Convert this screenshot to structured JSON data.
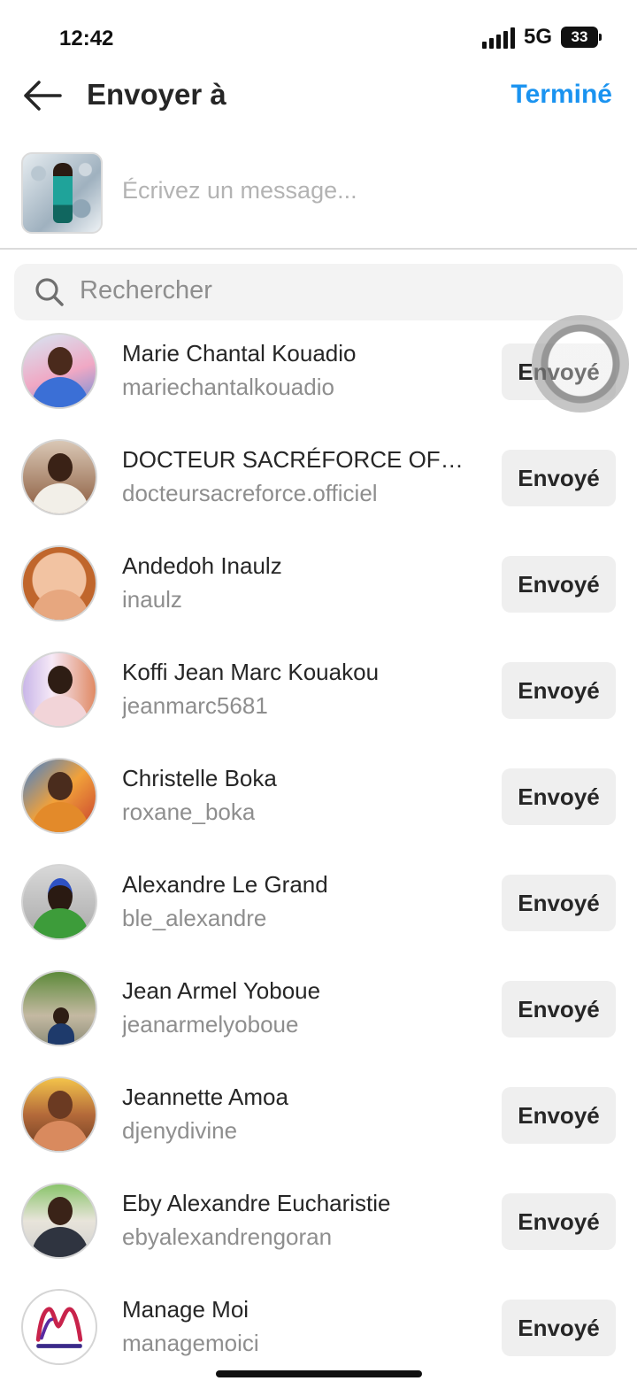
{
  "status_bar": {
    "time": "12:42",
    "network": "5G",
    "battery": "33"
  },
  "header": {
    "title": "Envoyer à",
    "done_label": "Terminé",
    "back_icon": "arrow-left-icon"
  },
  "compose": {
    "placeholder": "Écrivez un message..."
  },
  "search": {
    "placeholder": "Rechercher",
    "icon": "search-icon"
  },
  "contacts": [
    {
      "name": "Marie Chantal Kouadio",
      "handle": "mariechantalkouadio",
      "action": "Envoyé"
    },
    {
      "name": "DOCTEUR SACRÉFORCE OFFI...",
      "handle": "docteursacreforce.officiel",
      "action": "Envoyé"
    },
    {
      "name": "Andedoh Inaulz",
      "handle": "inaulz",
      "action": "Envoyé"
    },
    {
      "name": "Koffi Jean Marc Kouakou",
      "handle": "jeanmarc5681",
      "action": "Envoyé"
    },
    {
      "name": "Christelle Boka",
      "handle": "roxane_boka",
      "action": "Envoyé"
    },
    {
      "name": "Alexandre Le Grand",
      "handle": "ble_alexandre",
      "action": "Envoyé"
    },
    {
      "name": "Jean Armel Yoboue",
      "handle": "jeanarmelyoboue",
      "action": "Envoyé"
    },
    {
      "name": "Jeannette Amoa",
      "handle": "djenydivine",
      "action": "Envoyé"
    },
    {
      "name": "Eby Alexandre Eucharistie",
      "handle": "ebyalexandrengoran",
      "action": "Envoyé"
    },
    {
      "name": "Manage Moi",
      "handle": "managemoici",
      "action": "Envoyé"
    }
  ],
  "colors": {
    "accent": "#1a93f0",
    "text_primary": "#262626",
    "text_secondary": "#8e8e8e",
    "button_bg": "#efefef"
  }
}
